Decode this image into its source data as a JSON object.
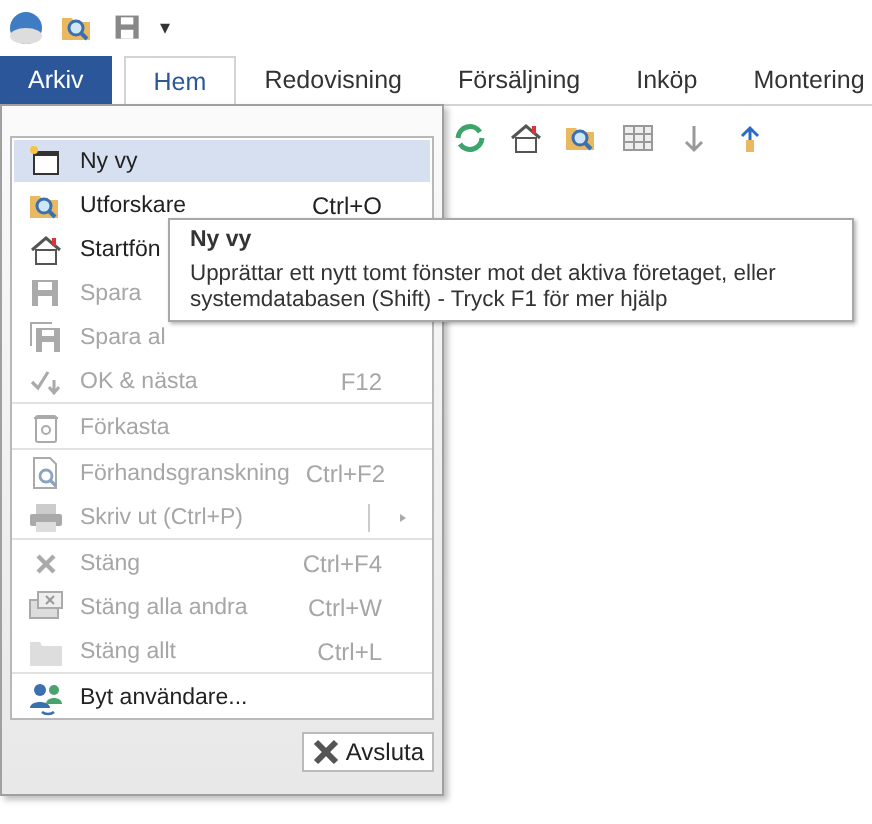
{
  "quick_access": {
    "menu_caret": "▾"
  },
  "tabs": [
    {
      "label": "Arkiv",
      "selected": false,
      "kind": "file"
    },
    {
      "label": "Hem",
      "selected": true,
      "kind": "tab"
    },
    {
      "label": "Redovisning",
      "selected": false,
      "kind": "tab"
    },
    {
      "label": "Försäljning",
      "selected": false,
      "kind": "tab"
    },
    {
      "label": "Inköp",
      "selected": false,
      "kind": "tab"
    },
    {
      "label": "Montering",
      "selected": false,
      "kind": "tab"
    }
  ],
  "file_menu": {
    "groups": [
      [
        {
          "label": "Ny vy",
          "selected": true,
          "disabled": false
        },
        {
          "label": "Utforskare",
          "shortcut": "Ctrl+O",
          "selected": false,
          "disabled": false
        },
        {
          "label": "Startfön",
          "selected": false,
          "disabled": false
        },
        {
          "label": "Spara",
          "selected": false,
          "disabled": true
        },
        {
          "label": "Spara al",
          "selected": false,
          "disabled": true
        },
        {
          "label": "OK & nästa",
          "shortcut": "F12",
          "selected": false,
          "disabled": true
        }
      ],
      [
        {
          "label": "Förkasta",
          "selected": false,
          "disabled": true
        }
      ],
      [
        {
          "label": "Förhandsgranskning",
          "shortcut": "Ctrl+F2",
          "selected": false,
          "disabled": true
        },
        {
          "label": "Skriv ut (Ctrl+P)",
          "selected": false,
          "disabled": true,
          "submenu": true
        }
      ],
      [
        {
          "label": "Stäng",
          "shortcut": "Ctrl+F4",
          "selected": false,
          "disabled": true
        },
        {
          "label": "Stäng alla andra",
          "shortcut": "Ctrl+W",
          "selected": false,
          "disabled": true
        },
        {
          "label": "Stäng allt",
          "shortcut": "Ctrl+L",
          "selected": false,
          "disabled": true
        }
      ],
      [
        {
          "label": "Byt användare...",
          "selected": false,
          "disabled": false
        }
      ]
    ],
    "exit_button": {
      "label": "Avsluta"
    }
  },
  "tooltip": {
    "title": "Ny vy",
    "text": "Upprättar ett nytt tomt fönster mot det aktiva företaget, eller systemdatabasen (Shift) - Tryck F1 för mer hjälp"
  }
}
